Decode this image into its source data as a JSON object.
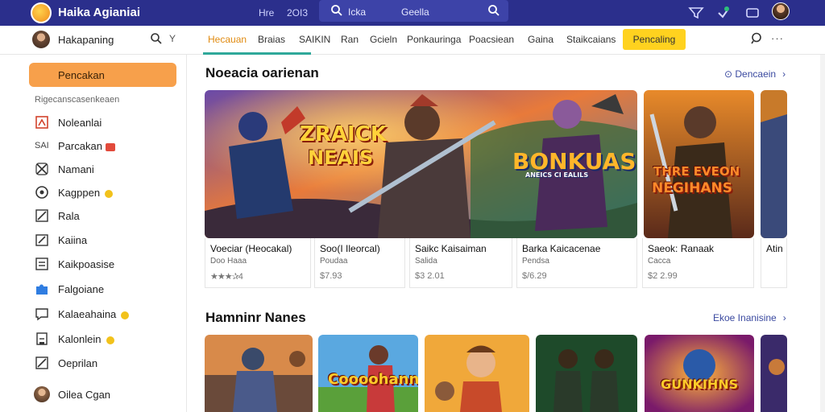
{
  "topbar": {
    "title": "Haika Agianiai",
    "mid1": "Hre",
    "mid2": "2OI3",
    "search_text1": "Icka",
    "search_text2": "Geella"
  },
  "navbar": {
    "user_name": "Hakapaning",
    "chevron": "Y",
    "tabs": [
      "Hecauan",
      "Braias",
      "SAIKIN",
      "Ran",
      "Gcieln",
      "Ponkauringa",
      "Poacsiean",
      "Gaina",
      "Staikcaians"
    ],
    "cta": "Pencaling",
    "more": "···"
  },
  "sidebar": {
    "active": "Pencakan",
    "section": "Rigecanscasenkeaen",
    "items": [
      {
        "label": "Noleanlai",
        "icon": "flag-icon"
      },
      {
        "label": "Parcakan",
        "prefix": "SAI",
        "icon": "none",
        "badge": "red"
      },
      {
        "label": "Namani",
        "icon": "cross-icon"
      },
      {
        "label": "Kagppen",
        "icon": "circle-icon",
        "badge": "yellow"
      },
      {
        "label": "Rala",
        "icon": "pencil-icon"
      },
      {
        "label": "Kaiina",
        "icon": "edit-icon"
      },
      {
        "label": "Kaikpoasise",
        "icon": "list-icon"
      },
      {
        "label": "Falgoiane",
        "icon": "puzzle-icon"
      },
      {
        "label": "Kalaeahaina",
        "icon": "message-icon",
        "badge": "yellow"
      },
      {
        "label": "Kalonlein",
        "icon": "note-icon",
        "badge": "yellow"
      },
      {
        "label": "Oeprilan",
        "icon": "edit-icon"
      }
    ],
    "bottom_label": "Oilea Cgan"
  },
  "section1": {
    "title": "Noeacia oarienan",
    "link": "Dencaein",
    "banner_text1": "ZRAICK",
    "banner_text2": "NEAIS",
    "banner_text3": "BONKUAS",
    "banner_text4": "ANEICS CI EALILS",
    "side_text1": "THRE EVEON",
    "side_text2": "NEGIHANS",
    "cards": [
      {
        "title": "Voeciar (Heocakal)",
        "sub": "Doo Haaa",
        "extra": "★★★✰4"
      },
      {
        "title": "Soo(I Ileorcal)",
        "sub": "Poudaa",
        "extra": "$7.93"
      },
      {
        "title": "Saikc Kaisaiman",
        "sub": "Salida",
        "extra": "$3 2.01"
      },
      {
        "title": "Barka Kaicacenae",
        "sub": "Pendsa",
        "extra": "$/6.29"
      },
      {
        "title": "Saeok: Ranaak",
        "sub": "Cacca",
        "extra": "$2 2.99"
      },
      {
        "title": "Atin",
        "sub": "",
        "extra": ""
      }
    ]
  },
  "section2": {
    "title": "Hamninr Nanes",
    "link": "Ekoe Inanisine",
    "tile_text1": "Coooohann",
    "tile_text2": "GUNKIHNS"
  },
  "colors": {
    "topbar": "#2b2f8c",
    "accent_orange": "#f7a04b",
    "cta_yellow": "#ffd21f",
    "tab_underline": "#2fa89a"
  }
}
